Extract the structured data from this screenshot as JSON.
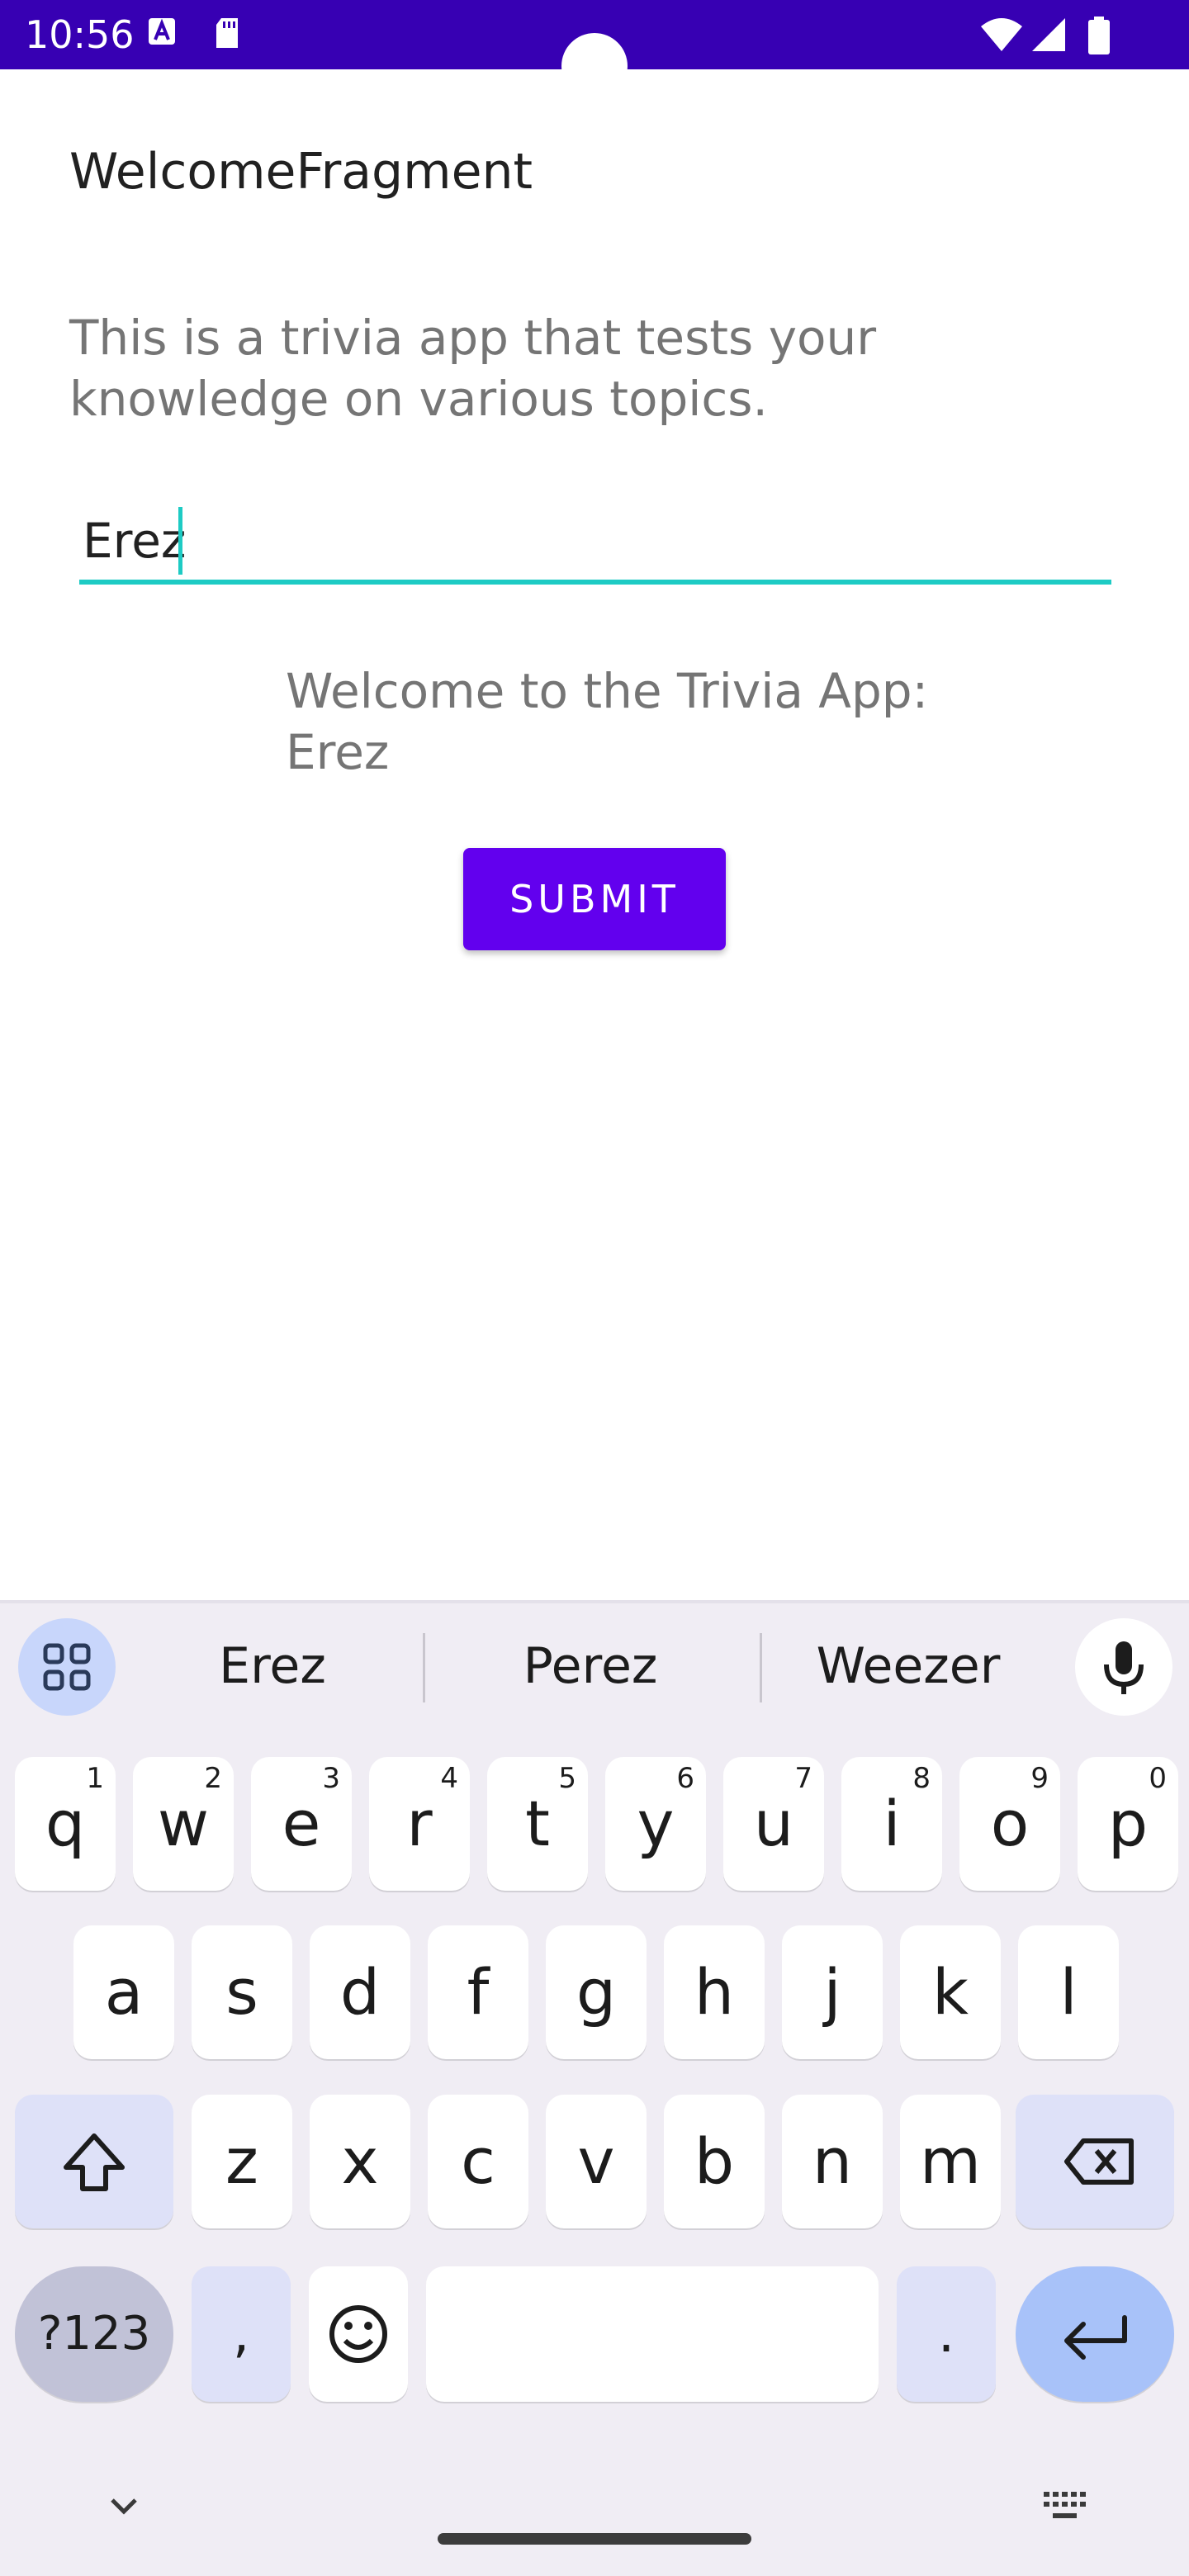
{
  "status_bar": {
    "time": "10:56",
    "icons": [
      "a-icon",
      "sd-card-icon",
      "wifi-icon",
      "signal-icon",
      "battery-icon"
    ]
  },
  "app": {
    "title": "WelcomeFragment",
    "description": "This is a trivia app that tests your knowledge on various topics.",
    "name_input_value": "Erez",
    "welcome_line1": "Welcome to the Trivia App:",
    "welcome_line2": "Erez",
    "submit_label": "SUBMIT",
    "colors": {
      "accent": "#6200ee",
      "status_bar": "#3700b3",
      "input_underline": "#1ecbc4"
    }
  },
  "keyboard": {
    "suggestions": [
      "Erez",
      "Perez",
      "Weezer"
    ],
    "row1": [
      {
        "ch": "q",
        "sup": "1"
      },
      {
        "ch": "w",
        "sup": "2"
      },
      {
        "ch": "e",
        "sup": "3"
      },
      {
        "ch": "r",
        "sup": "4"
      },
      {
        "ch": "t",
        "sup": "5"
      },
      {
        "ch": "y",
        "sup": "6"
      },
      {
        "ch": "u",
        "sup": "7"
      },
      {
        "ch": "i",
        "sup": "8"
      },
      {
        "ch": "o",
        "sup": "9"
      },
      {
        "ch": "p",
        "sup": "0"
      }
    ],
    "row2": [
      "a",
      "s",
      "d",
      "f",
      "g",
      "h",
      "j",
      "k",
      "l"
    ],
    "row3": [
      "z",
      "x",
      "c",
      "v",
      "b",
      "n",
      "m"
    ],
    "sym_label": "?123",
    "comma": ",",
    "period": ".",
    "icons": [
      "apps-grid-icon",
      "mic-icon",
      "shift-icon",
      "backspace-icon",
      "emoji-icon",
      "enter-icon",
      "chevron-down-icon",
      "keyboard-icon"
    ]
  }
}
